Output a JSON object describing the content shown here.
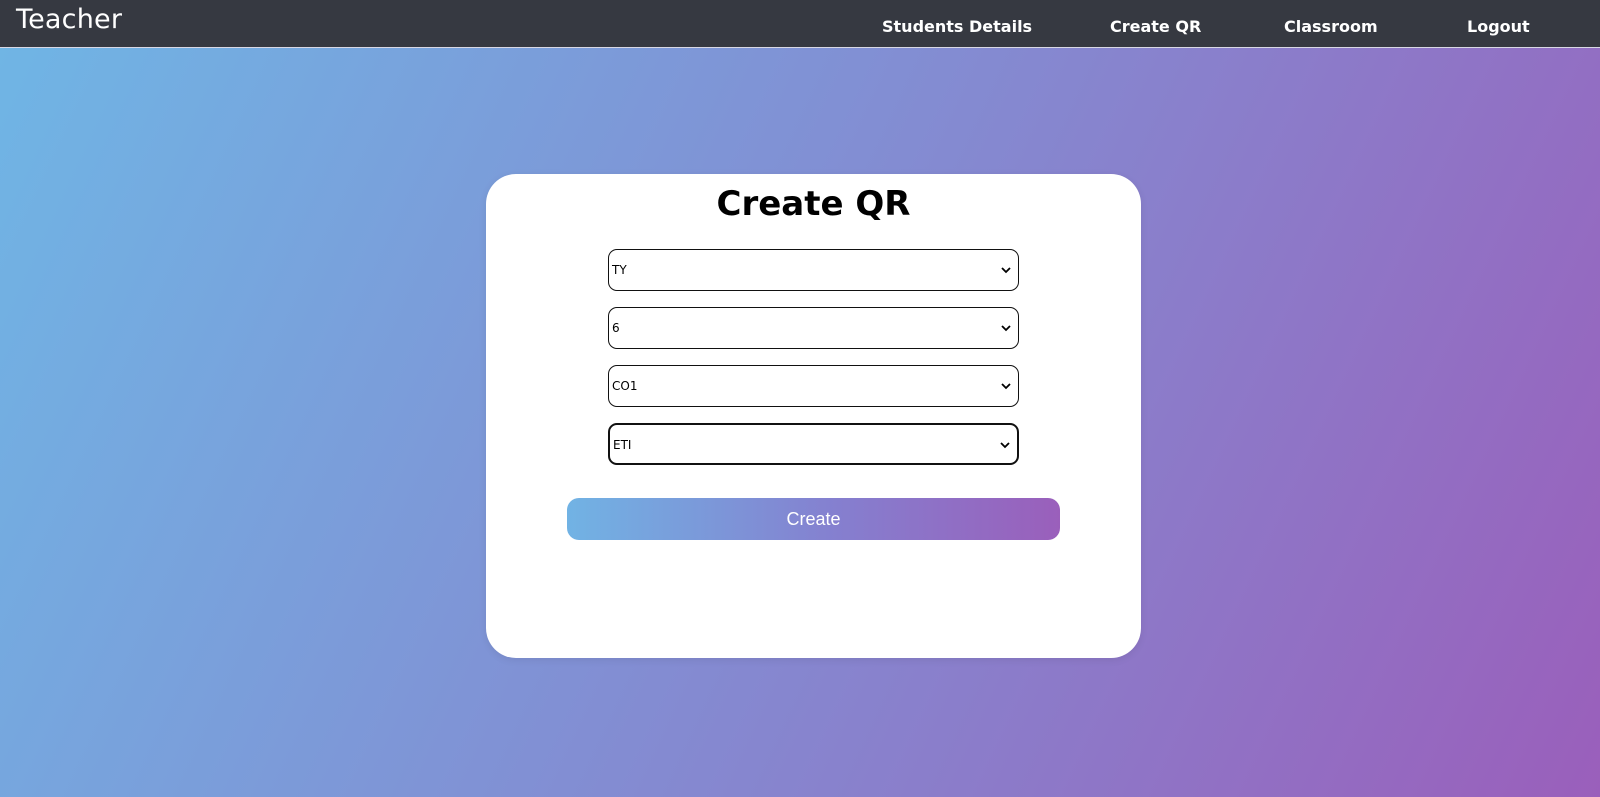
{
  "navbar": {
    "brand": "Teacher",
    "links": [
      {
        "label": "Students Details"
      },
      {
        "label": "Create QR"
      },
      {
        "label": "Classroom"
      },
      {
        "label": "Logout"
      }
    ]
  },
  "card": {
    "title": "Create QR",
    "selects": [
      {
        "value": "TY"
      },
      {
        "value": "6"
      },
      {
        "value": "CO1"
      },
      {
        "value": "ETI"
      }
    ],
    "create_label": "Create"
  },
  "colors": {
    "navbar_bg": "#363941",
    "gradient_start": "#6fb6e5",
    "gradient_end": "#9a5fbb"
  },
  "icons": {
    "select_chevron": "chevron-down-icon"
  }
}
